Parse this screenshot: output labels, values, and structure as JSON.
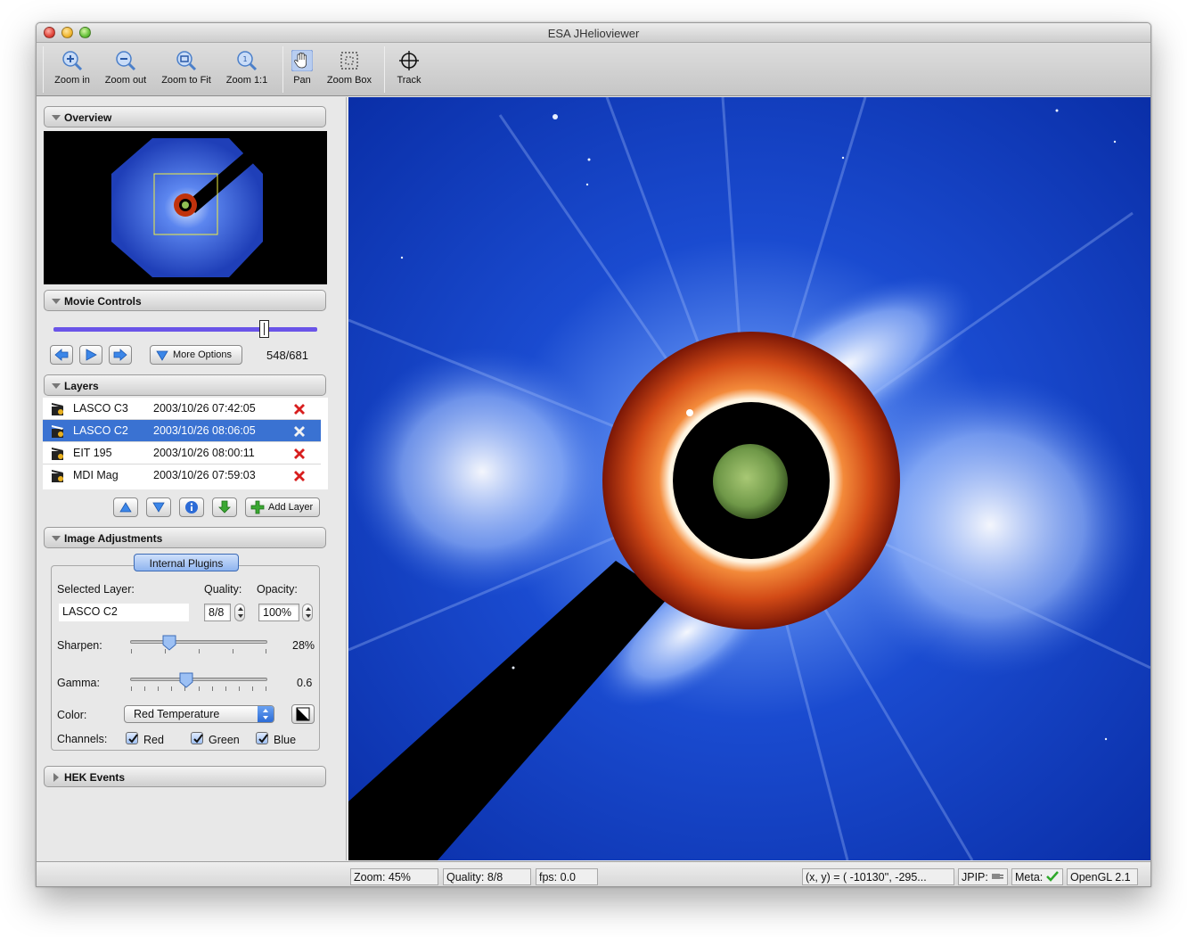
{
  "window": {
    "title": "ESA JHelioviewer"
  },
  "toolbar": {
    "zoom_in": "Zoom in",
    "zoom_out": "Zoom out",
    "zoom_fit": "Zoom to Fit",
    "zoom_1_1": "Zoom 1:1",
    "pan": "Pan",
    "zoom_box": "Zoom Box",
    "track": "Track"
  },
  "sections": {
    "overview": "Overview",
    "movie_controls": "Movie Controls",
    "layers": "Layers",
    "image_adjustments": "Image Adjustments",
    "hek_events": "HEK Events"
  },
  "movie": {
    "more_options": "More Options",
    "frame": "548/681",
    "position_fraction": 0.8
  },
  "layers": {
    "items": [
      {
        "name": "LASCO C3",
        "date": "2003/10/26 07:42:05",
        "selected": false
      },
      {
        "name": "LASCO C2",
        "date": "2003/10/26 08:06:05",
        "selected": true
      },
      {
        "name": "EIT 195",
        "date": "2003/10/26 08:00:11",
        "selected": false
      },
      {
        "name": "MDI Mag",
        "date": "2003/10/26 07:59:03",
        "selected": false
      }
    ],
    "add_layer": "Add Layer"
  },
  "adjustments": {
    "tab": "Internal Plugins",
    "selected_layer_label": "Selected Layer:",
    "selected_layer_value": "LASCO C2",
    "quality_label": "Quality:",
    "quality_value": "8/8",
    "opacity_label": "Opacity:",
    "opacity_value": "100%",
    "sharpen_label": "Sharpen:",
    "sharpen_value": "28%",
    "gamma_label": "Gamma:",
    "gamma_value": "0.6",
    "color_label": "Color:",
    "color_value": "Red Temperature",
    "channels_label": "Channels:",
    "channels": {
      "red": "Red",
      "green": "Green",
      "blue": "Blue"
    }
  },
  "status": {
    "zoom": "Zoom: 45%",
    "quality": "Quality: 8/8",
    "fps": "fps: 0.0",
    "coords": "(x, y) = ( -10130'', -295...",
    "jpip": "JPIP:",
    "meta": "Meta:",
    "opengl": "OpenGL 2.1"
  },
  "colors": {
    "accent": "#3a72d2",
    "slider": "#6a54e8",
    "solar_field": "#0a35b8",
    "occulter_ring": "#c83a10",
    "delete": "#d81e1e"
  },
  "icons": [
    "zoom-in-icon",
    "zoom-out-icon",
    "zoom-fit-icon",
    "zoom-one-to-one-icon",
    "hand-icon",
    "zoom-box-icon",
    "crosshair-icon",
    "arrow-left-icon",
    "play-icon",
    "arrow-right-icon",
    "triangle-down-icon",
    "clapperboard-icon",
    "delete-icon",
    "arrow-up-icon",
    "info-icon",
    "download-icon",
    "plus-icon",
    "checkmark-icon",
    "plug-icon"
  ]
}
